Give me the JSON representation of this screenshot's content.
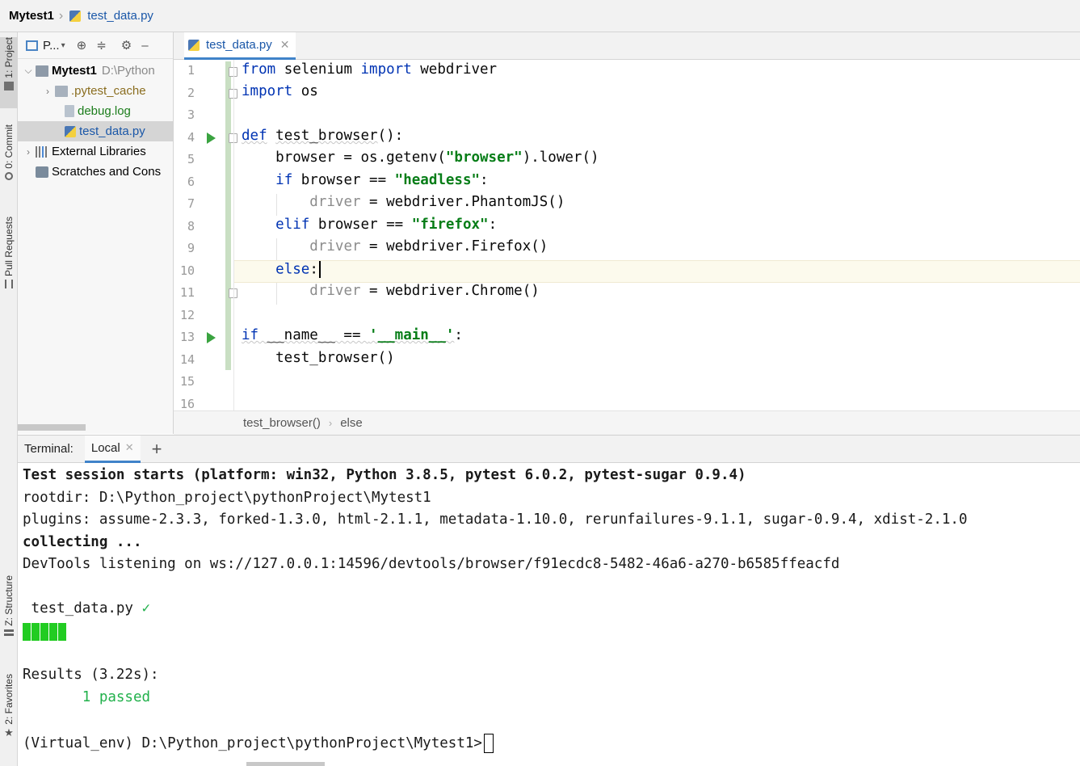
{
  "breadcrumb": {
    "project": "Mytest1",
    "file": "test_data.py"
  },
  "left_strip": {
    "project_tab": "1: Project",
    "commit_tab": "0: Commit",
    "pull_requests_tab": "Pull Requests",
    "structure_tab": "Z: Structure",
    "favorites_tab": "2: Favorites"
  },
  "project_panel": {
    "toolbar_label": "P...",
    "tree": [
      {
        "label": "Mytest1",
        "hint": "D:\\Python"
      },
      {
        "label": ".pytest_cache"
      },
      {
        "label": "debug.log"
      },
      {
        "label": "test_data.py"
      },
      {
        "label": "External Libraries"
      },
      {
        "label": "Scratches and Cons"
      }
    ]
  },
  "editor": {
    "tab_label": "test_data.py",
    "line_numbers": [
      "1",
      "2",
      "3",
      "4",
      "5",
      "6",
      "7",
      "8",
      "9",
      "10",
      "11",
      "12",
      "13",
      "14",
      "15",
      "16"
    ],
    "code": {
      "l1": {
        "kw1": "from",
        "t1": " selenium ",
        "kw2": "import",
        "t2": " webdriver"
      },
      "l2": {
        "kw1": "import",
        "t1": " os"
      },
      "l4": {
        "kw1": "def",
        "t1": " ",
        "fn": "test_browser",
        "t2": "():"
      },
      "l5": {
        "t1": "    browser = os.getenv(",
        "s1": "\"browser\"",
        "t2": ").lower()"
      },
      "l6": {
        "t0": "    ",
        "kw1": "if",
        "t1": " browser == ",
        "s1": "\"headless\"",
        "t2": ":"
      },
      "l7": {
        "t0": "        ",
        "g1": "driver",
        "t1": " = webdriver.PhantomJS()"
      },
      "l8": {
        "t0": "    ",
        "kw1": "elif",
        "t1": " browser == ",
        "s1": "\"firefox\"",
        "t2": ":"
      },
      "l9": {
        "t0": "        ",
        "g1": "driver",
        "t1": " = webdriver.Firefox()"
      },
      "l10": {
        "t0": "    ",
        "kw1": "else",
        "t1": ":"
      },
      "l11": {
        "t0": "        ",
        "g1": "driver",
        "t1": " = webdriver.Chrome()"
      },
      "l13": {
        "kw1": "if",
        "t1": " __name__ == ",
        "s1": "'__main__'",
        "t2": ":"
      },
      "l14": {
        "t1": "    test_browser()"
      }
    },
    "breadcrumb": [
      "test_browser()",
      "else"
    ]
  },
  "terminal": {
    "title": "Terminal:",
    "tab_label": "Local",
    "lines": {
      "session": "Test session starts (platform: win32, Python 3.8.5, pytest 6.0.2, pytest-sugar 0.9.4)",
      "rootdir": "rootdir: D:\\Python_project\\pythonProject\\Mytest1",
      "plugins": "plugins: assume-2.3.3, forked-1.3.0, html-2.1.1, metadata-1.10.0, rerunfailures-9.1.1, sugar-0.9.4, xdist-2.1.0",
      "collecting": "collecting ...",
      "devtools": "DevTools listening on ws://127.0.0.1:14596/devtools/browser/f91ecdc8-5482-46a6-a270-b6585ffeacfd",
      "test_file": " test_data.py ",
      "check": "✓",
      "results": "Results (3.22s):",
      "passed": "       1 passed",
      "prompt": "(Virtual_env) D:\\Python_project\\pythonProject\\Mytest1>"
    },
    "progress_blocks": 5
  },
  "colors": {
    "keyword": "#0033b3",
    "string": "#067d17",
    "accent": "#4083c9",
    "pass_green": "#22b14c"
  }
}
